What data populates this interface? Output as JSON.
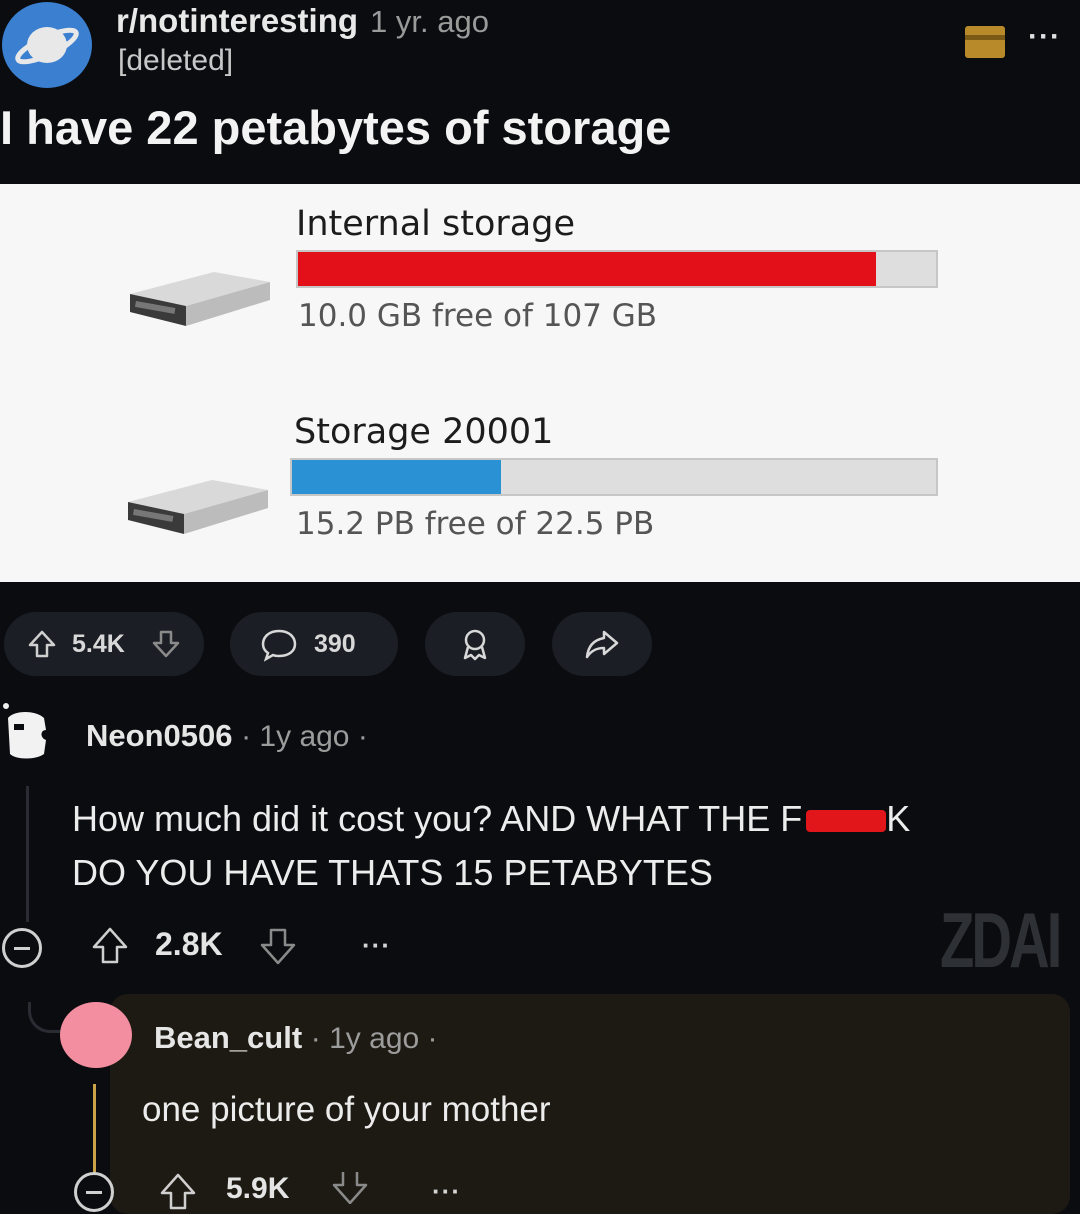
{
  "header": {
    "subreddit": "r/notinteresting",
    "age": "1 yr. ago",
    "author": "[deleted]",
    "more_label": "···"
  },
  "post": {
    "title": "I have 22 petabytes of storage",
    "image": {
      "drives": [
        {
          "label": "Internal storage",
          "free_text": "10.0 GB free of 107 GB",
          "used_fraction": 0.906,
          "bar_color": "#e3101a",
          "icon": "hard-drive-icon"
        },
        {
          "label": "Storage 20001",
          "free_text": "15.2 PB free of 22.5 PB",
          "used_fraction": 0.324,
          "bar_color": "#2a92d4",
          "icon": "hard-drive-icon"
        }
      ]
    },
    "actions": {
      "upvotes": "5.4K",
      "comments": "390"
    }
  },
  "comments": [
    {
      "user": "Neon0506",
      "meta": "· 1y ago ·",
      "body_line1": "How much did it cost you? AND WHAT THE F",
      "body_line1_end": "K",
      "body_line2": "DO YOU HAVE THATS 15 PETABYTES",
      "votes": "2.8K",
      "more_label": "···"
    },
    {
      "user": "Bean_cult",
      "meta": "· 1y ago ·",
      "body": "one picture of your mother",
      "votes": "5.9K",
      "more_label": "···"
    }
  ],
  "watermark": "ZDAI",
  "colors": {
    "background": "#0b0c10",
    "internal_bar": "#e3101a",
    "storage_bar": "#2a92d4",
    "reply_accent": "#c9a24a"
  }
}
